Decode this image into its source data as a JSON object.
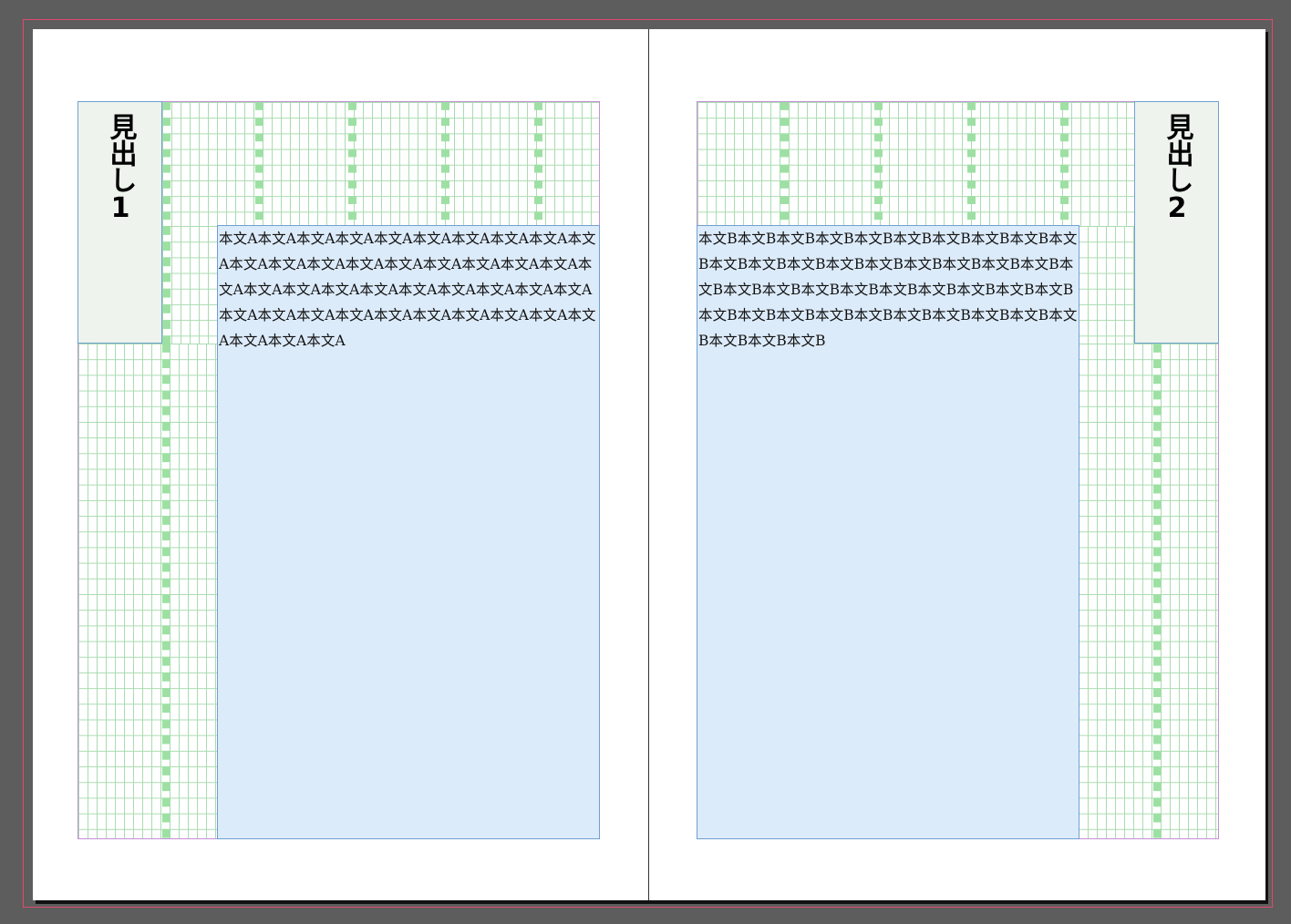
{
  "document": {
    "colors": {
      "pasteboard": "#5d5d5d",
      "page": "#ffffff",
      "bleed_guide": "#e2486e",
      "margin_guide": "#c58fd6",
      "frame_edge": "#6fa0d0",
      "layout_grid": "#a9dcb0",
      "grid_gutter": "#9ee0a4",
      "text_frame_fill": "#dcebfa",
      "heading_frame_fill": "#eef3ee"
    },
    "left_page": {
      "heading": "見出し1",
      "body_text": "本文A本文A本文A本文A本文A本文A本文A本文A本文A本文A本文A本文A本文A本文A本文A本文A本文A本文A本文A本文A本文A本文A本文A本文A本文A本文A本文A本文A本文A本文A本文A本文A本文A本文A本文A本文A本文A本文A本文A本文A本文A本文A"
    },
    "right_page": {
      "heading": "見出し2",
      "body_text": "本文B本文B本文B本文B本文B本文B本文B本文B本文B本文B本文B本文B本文B本文B本文B本文B本文B本文B本文B本文B本文B本文B本文B本文B本文B本文B本文B本文B本文B本文B本文B本文B本文B本文B本文B本文B本文B本文B本文B本文B本文B本文B"
    }
  }
}
